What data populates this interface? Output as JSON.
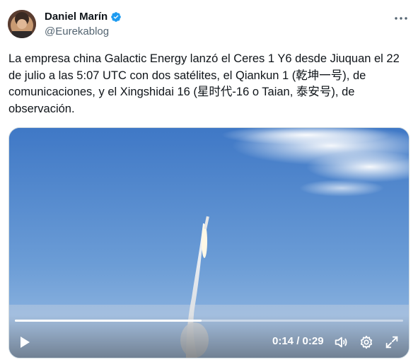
{
  "author": {
    "display_name": "Daniel Marín",
    "handle": "@Eurekablog",
    "verified": true
  },
  "tweet": {
    "text": "La empresa china Galactic Energy lanzó el Ceres 1 Y6 desde Jiuquan el 22 de julio a las 5:07 UTC con dos satélites, el Qiankun 1 (乾坤一号), de comunicaciones, y el Xingshidai 16 (星时代-16 o Taian, 泰安号), de observación."
  },
  "video": {
    "current_time": "0:14",
    "duration": "0:29",
    "time_display": "0:14 / 0:29",
    "progress_fraction": 0.48
  },
  "icons": {
    "verified": "verified-badge-icon",
    "more": "more-options-icon",
    "play": "play-icon",
    "volume": "volume-icon",
    "settings": "settings-gear-icon",
    "fullscreen": "fullscreen-icon"
  },
  "colors": {
    "verified_blue": "#1d9bf0",
    "text": "#0f1419",
    "secondary_text": "#536471"
  }
}
